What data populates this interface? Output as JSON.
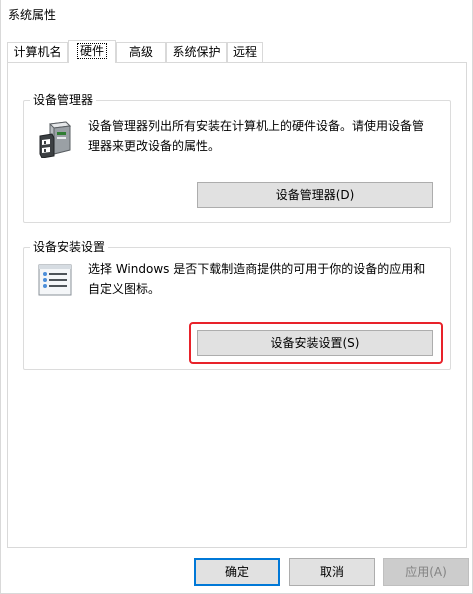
{
  "window": {
    "title": "系统属性"
  },
  "tabs": [
    {
      "label": "计算机名",
      "active": false
    },
    {
      "label": "硬件",
      "active": true
    },
    {
      "label": "高级",
      "active": false
    },
    {
      "label": "系统保护",
      "active": false
    },
    {
      "label": "远程",
      "active": false
    }
  ],
  "device_manager": {
    "group_label": "设备管理器",
    "description_line1": "设备管理器列出所有安装在计算机上的硬件设备。请使用设备管",
    "description_line2": "理器来更改设备的属性。",
    "button_label": "设备管理器(D)",
    "icon": "device-manager-icon"
  },
  "device_installation": {
    "group_label": "设备安装设置",
    "description_line1": "选择 Windows 是否下载制造商提供的可用于你的设备的应用和",
    "description_line2": "自定义图标。",
    "button_label": "设备安装设置(S)",
    "icon": "installation-settings-icon",
    "highlight_color": "#e8222a"
  },
  "footer": {
    "ok_label": "确定",
    "cancel_label": "取消",
    "apply_label": "应用(A)"
  },
  "colors": {
    "accent": "#0078d7",
    "button_face": "#e1e1e1",
    "border": "#d9d9d9"
  }
}
